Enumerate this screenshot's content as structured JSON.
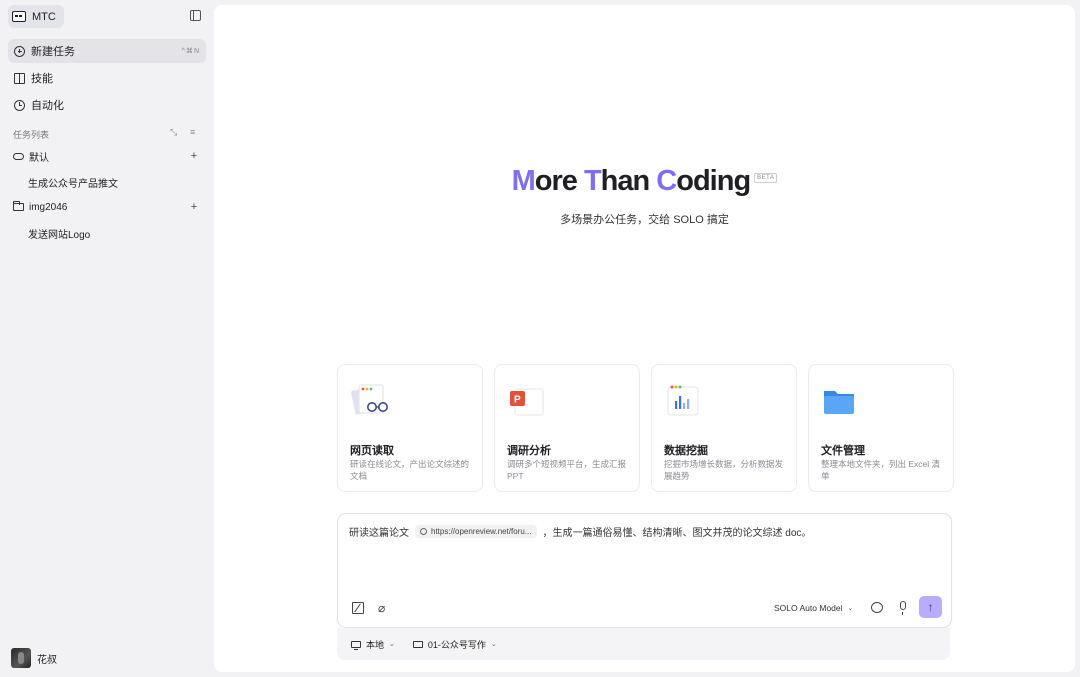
{
  "sidebar": {
    "brand": "MTC",
    "nav": [
      {
        "label": "新建任务",
        "shortcut": "^⌘N",
        "icon": "plus-circle-icon",
        "active": true
      },
      {
        "label": "技能",
        "icon": "book-icon"
      },
      {
        "label": "自动化",
        "icon": "clock-icon"
      }
    ],
    "task_list_title": "任务列表",
    "groups": [
      {
        "label": "默认",
        "icon": "cloud-icon",
        "tasks": [
          "生成公众号产品推文"
        ]
      },
      {
        "label": "img2046",
        "icon": "folder-icon",
        "tasks": [
          "发送网站Logo"
        ]
      }
    ],
    "user": {
      "name": "花叔"
    }
  },
  "hero": {
    "title_parts": [
      {
        "text": "M",
        "accent": true
      },
      {
        "text": "ore ",
        "accent": false
      },
      {
        "text": "T",
        "accent": true
      },
      {
        "text": "han ",
        "accent": false
      },
      {
        "text": "C",
        "accent": true
      },
      {
        "text": "oding",
        "accent": false
      }
    ],
    "badge": "BETA",
    "subtitle": "多场景办公任务，交给 SOLO 搞定"
  },
  "cards": [
    {
      "title": "网页读取",
      "desc": "研读在线论文，产出论文综述的文档"
    },
    {
      "title": "调研分析",
      "desc": "调研多个短视频平台，生成汇报 PPT"
    },
    {
      "title": "数据挖掘",
      "desc": "挖掘市场增长数据，分析数据发展趋势"
    },
    {
      "title": "文件管理",
      "desc": "整理本地文件夹，列出 Excel 清单"
    }
  ],
  "composer": {
    "prefix": "研读这篇论文",
    "link": "https://openreview.net/foru...",
    "suffix": "，生成一篇通俗易懂、结构清晰、图文并茂的论文综述 doc。",
    "model": "SOLO Auto Model",
    "send_icon": "↑"
  },
  "workspace": {
    "location": "本地",
    "folder": "01-公众号写作"
  },
  "colors": {
    "accent": "#7e6ff0",
    "send_button": "#b9acfa",
    "sidebar_bg": "#f2f2f4"
  }
}
